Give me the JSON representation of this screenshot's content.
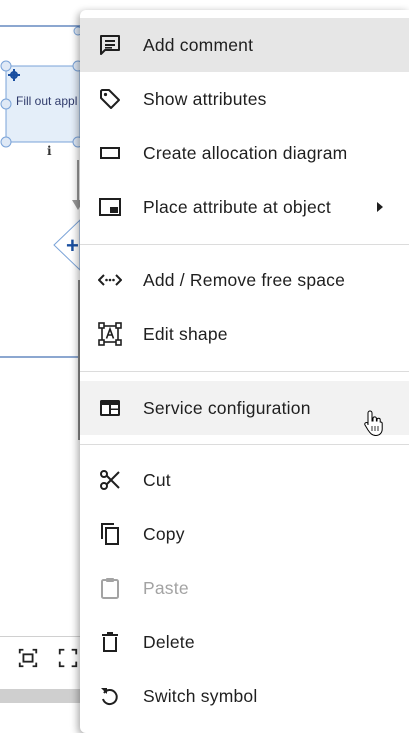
{
  "canvas": {
    "shape_label": "Fill out appl"
  },
  "menu": {
    "items": [
      {
        "label": "Add comment",
        "icon": "comment-icon"
      },
      {
        "label": "Show attributes",
        "icon": "tag-icon"
      },
      {
        "label": "Create allocation diagram",
        "icon": "rectangle-icon"
      },
      {
        "label": "Place attribute at object",
        "icon": "picture-in-picture-icon",
        "submenu": true
      },
      {
        "label": "Add / Remove free space",
        "icon": "free-space-icon"
      },
      {
        "label": "Edit shape",
        "icon": "edit-shape-icon"
      },
      {
        "label": "Service configuration",
        "icon": "service-configuration-icon"
      },
      {
        "label": "Cut",
        "icon": "scissors-icon"
      },
      {
        "label": "Copy",
        "icon": "copy-icon"
      },
      {
        "label": "Paste",
        "icon": "clipboard-icon",
        "disabled": true
      },
      {
        "label": "Delete",
        "icon": "trash-icon"
      },
      {
        "label": "Switch symbol",
        "icon": "rotate-icon"
      }
    ]
  },
  "colors": {
    "menu_active": "#e6e6e6",
    "menu_hover": "#f2f2f2",
    "disabled_text": "#a3a3a3",
    "canvas_blue": "#1a4fa0",
    "shape_fill": "#e4eef9"
  }
}
